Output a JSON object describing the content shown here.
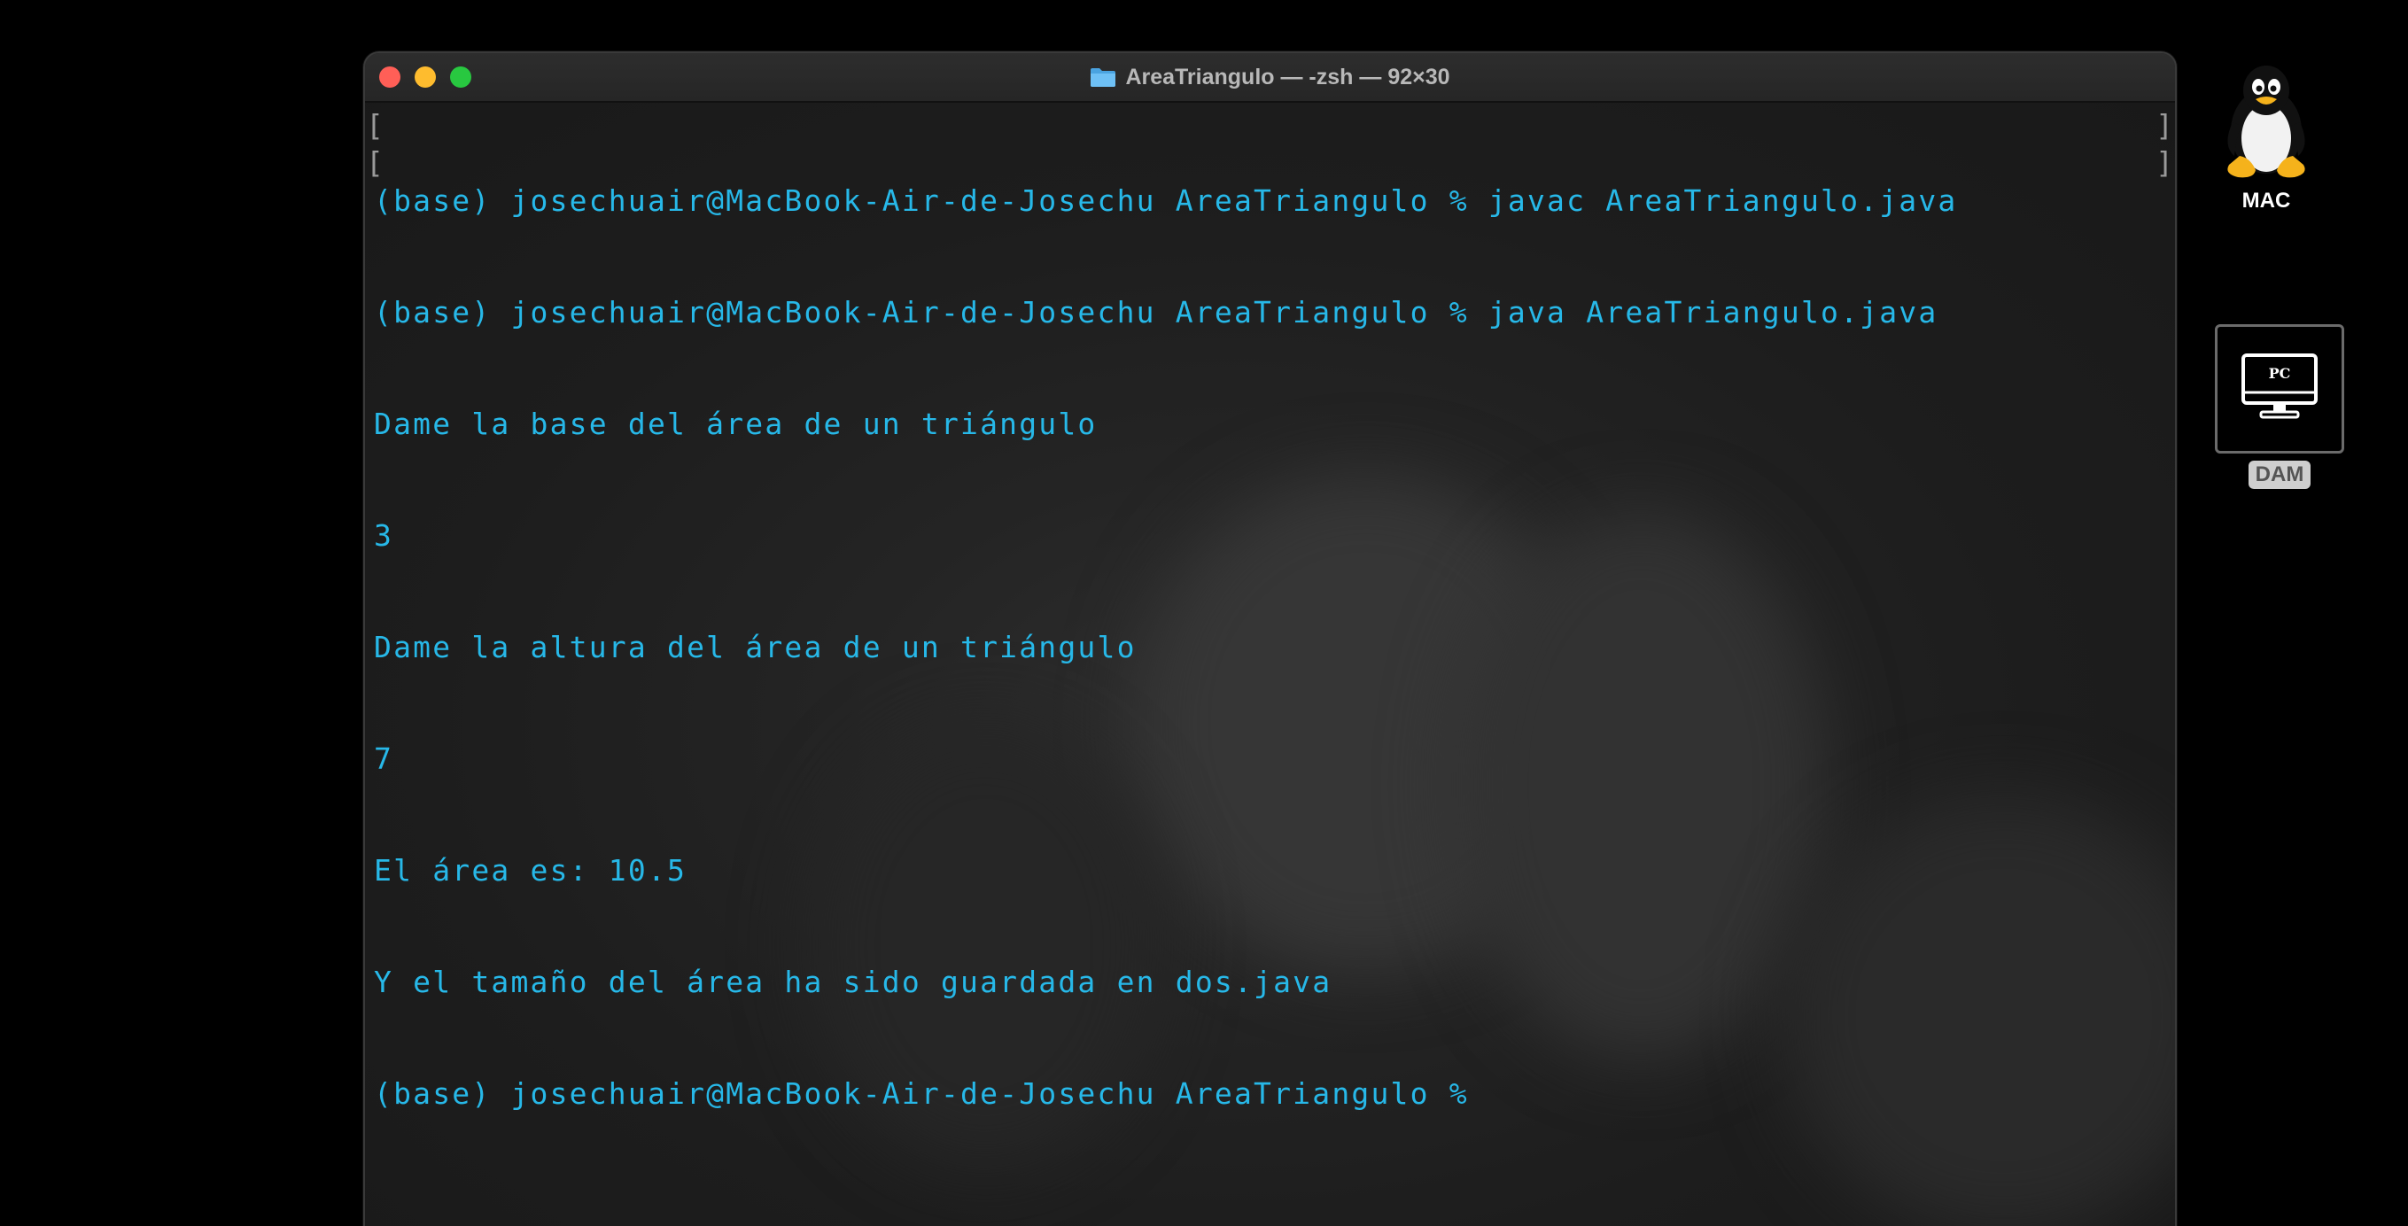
{
  "window": {
    "title": "AreaTriangulo — -zsh — 92×30"
  },
  "terminal": {
    "lines": [
      "(base) josechuair@MacBook-Air-de-Josechu AreaTriangulo % javac AreaTriangulo.java",
      "(base) josechuair@MacBook-Air-de-Josechu AreaTriangulo % java AreaTriangulo.java",
      "Dame la base del área de un triángulo",
      "3",
      "Dame la altura del área de un triángulo",
      "7",
      "El área es: 10.5",
      "Y el tamaño del área ha sido guardada en dos.java",
      "(base) josechuair@MacBook-Air-de-Josechu AreaTriangulo % "
    ],
    "text_color": "#27b8e8"
  },
  "desktop": {
    "icons": [
      {
        "label": "MAC",
        "icon": "tux-penguin-icon"
      },
      {
        "label": "DAM",
        "icon": "pc-monitor-icon",
        "inner_text": "PC"
      }
    ]
  },
  "colors": {
    "close": "#ff5f57",
    "minimize": "#febc2e",
    "maximize": "#28c840"
  }
}
